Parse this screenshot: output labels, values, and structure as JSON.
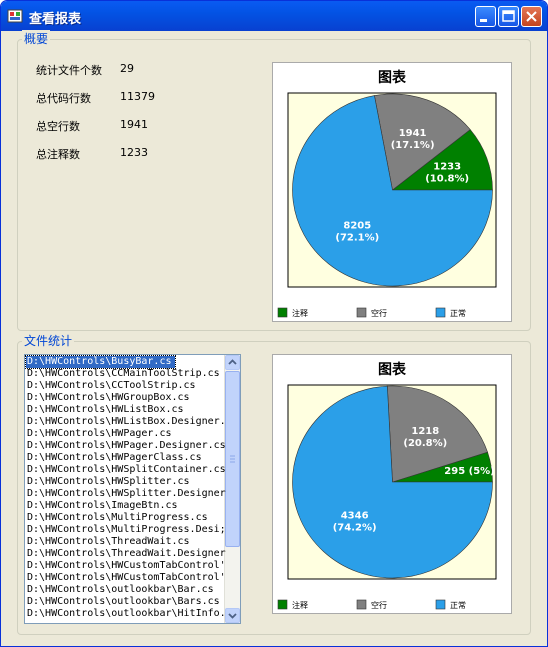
{
  "window": {
    "title": "查看报表"
  },
  "summary": {
    "group_title": "概要",
    "stats": [
      {
        "label": "统计文件个数",
        "value": "29"
      },
      {
        "label": "总代码行数",
        "value": "11379"
      },
      {
        "label": "总空行数",
        "value": "1941"
      },
      {
        "label": "总注释数",
        "value": "1233"
      }
    ]
  },
  "files": {
    "group_title": "文件统计",
    "items": [
      "D:\\HWControls\\BusyBar.cs",
      "D:\\HWControls\\CCMainToolStrip.cs",
      "D:\\HWControls\\CCToolStrip.cs",
      "D:\\HWControls\\HWGroupBox.cs",
      "D:\\HWControls\\HWListBox.cs",
      "D:\\HWControls\\HWListBox.Designer.",
      "D:\\HWControls\\HWPager.cs",
      "D:\\HWControls\\HWPager.Designer.cs",
      "D:\\HWControls\\HWPagerClass.cs",
      "D:\\HWControls\\HWSplitContainer.cs",
      "D:\\HWControls\\HWSplitter.cs",
      "D:\\HWControls\\HWSplitter.Designer",
      "D:\\HWControls\\ImageBtn.cs",
      "D:\\HWControls\\MultiProgress.cs",
      "D:\\HWControls\\MultiProgress.Desi;",
      "D:\\HWControls\\ThreadWait.cs",
      "D:\\HWControls\\ThreadWait.Designer",
      "D:\\HWControls\\HWCustomTabControl'",
      "D:\\HWControls\\HWCustomTabControl'",
      "D:\\HWControls\\outlookbar\\Bar.cs",
      "D:\\HWControls\\outlookbar\\Bars.cs",
      "D:\\HWControls\\outlookbar\\HitInfo."
    ],
    "selected_index": 0
  },
  "colors": {
    "comment": "#008000",
    "blank": "#808080",
    "normal": "#2b9fe8",
    "plot_bg": "#ffffe0"
  },
  "chart_data": [
    {
      "type": "pie",
      "title": "图表",
      "labels": [
        "注释",
        "空行",
        "正常"
      ],
      "values": [
        1233,
        1941,
        8205
      ],
      "value_labels": [
        "1233\n(10.8%)",
        "1941\n(17.1%)",
        "8205\n(72.1%)"
      ],
      "legend_position": "bottom"
    },
    {
      "type": "pie",
      "title": "图表",
      "labels": [
        "注释",
        "空行",
        "正常"
      ],
      "values": [
        295,
        1218,
        4346
      ],
      "value_labels": [
        "295 (5%)",
        "1218\n(20.8%)",
        "4346\n(74.2%)"
      ],
      "legend_position": "bottom"
    }
  ]
}
